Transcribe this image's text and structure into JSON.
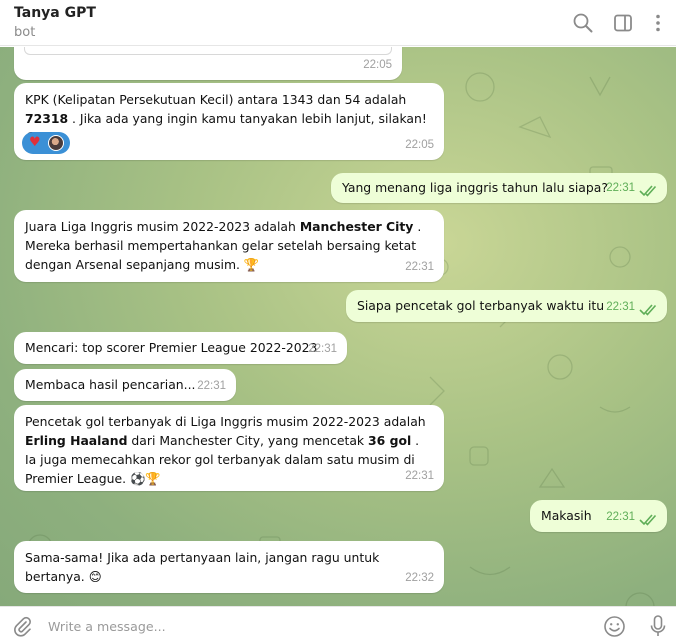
{
  "header": {
    "title": "Tanya GPT",
    "subtitle": "bot",
    "icons": [
      "search-icon",
      "sidebar-toggle-icon",
      "more-vertical-icon"
    ]
  },
  "messages": [
    {
      "id": "m0",
      "dir": "in",
      "time": "22:05",
      "text": ""
    },
    {
      "id": "m1",
      "dir": "in",
      "time": "22:05",
      "text_before": "KPK (Kelipatan Persekutuan Kecil) antara 1343 dan 54 adalah ",
      "bold1": "72318",
      "text_after": " . Jika ada yang ingin kamu tanyakan lebih lanjut, silakan! 😊",
      "reactions": [
        "❤️",
        "avatar"
      ]
    },
    {
      "id": "m2",
      "dir": "out",
      "time": "22:31",
      "text": "Yang menang liga inggris tahun lalu siapa?",
      "read": true
    },
    {
      "id": "m3",
      "dir": "in",
      "time": "22:31",
      "text_before": "Juara Liga Inggris musim 2022-2023 adalah ",
      "bold1": "Manchester City",
      "text_after": " . Mereka berhasil mempertahankan gelar setelah bersaing ketat dengan Arsenal sepanjang musim. 🏆"
    },
    {
      "id": "m4",
      "dir": "out",
      "time": "22:31",
      "text": "Siapa pencetak gol terbanyak waktu itu",
      "read": true
    },
    {
      "id": "m5",
      "dir": "in",
      "time": "22:31",
      "text": "Mencari: top scorer Premier League 2022-2023"
    },
    {
      "id": "m6",
      "dir": "in",
      "time": "22:31",
      "text": "Membaca hasil pencarian..."
    },
    {
      "id": "m7",
      "dir": "in",
      "time": "22:31",
      "text_before": "Pencetak gol terbanyak di Liga Inggris musim 2022-2023 adalah ",
      "bold1": "Erling Haaland",
      "text_mid": "  dari Manchester City, yang mencetak ",
      "bold2": "36 gol",
      "text_after": " . Ia juga memecahkan rekor gol terbanyak dalam satu musim di Premier League. ⚽🏆"
    },
    {
      "id": "m8",
      "dir": "out",
      "time": "22:31",
      "text": "Makasih",
      "read": true
    },
    {
      "id": "m9",
      "dir": "in",
      "time": "22:32",
      "text": "Sama-sama! Jika ada pertanyaan lain, jangan ragu untuk bertanya. 😊"
    }
  ],
  "composer": {
    "placeholder": "Write a message...",
    "icons": [
      "paperclip-icon",
      "emoji-icon",
      "microphone-icon"
    ]
  },
  "colors": {
    "incoming_bubble": "#ffffff",
    "outgoing_bubble": "#eefed7",
    "timestamp_out": "#5fae58",
    "reaction_badge": "#3b90d6"
  }
}
